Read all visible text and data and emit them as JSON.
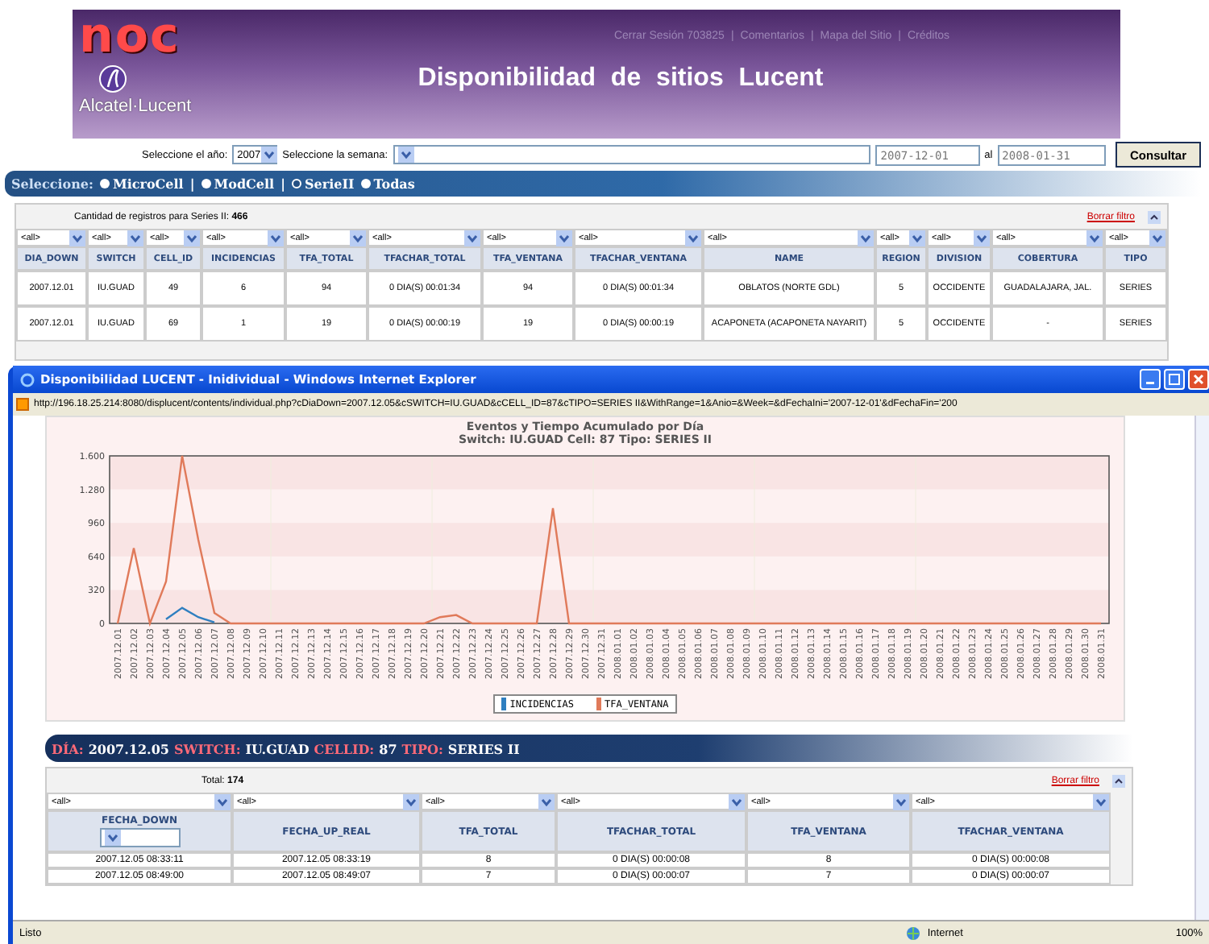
{
  "header": {
    "logo_text": "noc",
    "brand": "Alcatel·Lucent",
    "links": [
      "Cerrar Sesión 703825",
      "Comentarios",
      "Mapa del Sitio",
      "Créditos"
    ],
    "link_separator": "|",
    "title": "Disponibilidad de sitios Lucent"
  },
  "query": {
    "year_label": "Seleccione el año:",
    "year": "2007",
    "week_label": "Seleccione la semana:",
    "date_from": "2007-12-01",
    "range_sep": "al",
    "date_to": "2008-01-31",
    "submit": "Consultar"
  },
  "selector": {
    "label": "Seleccione:",
    "separator": "|",
    "options": [
      {
        "label": "MicroCell",
        "selected": false
      },
      {
        "label": "ModCell",
        "selected": false
      },
      {
        "label": "SerieII",
        "selected": true
      },
      {
        "label": "Todas",
        "selected": false
      }
    ]
  },
  "main_table": {
    "summary": "Cantidad de registros para Series II: **466**",
    "clear_filter": "Borrar filtro",
    "columns": [
      {
        "name": "DIA_DOWN",
        "filter": "<all>"
      },
      {
        "name": "SWITCH",
        "filter": "<all>"
      },
      {
        "name": "CELL_ID",
        "filter": "<all>"
      },
      {
        "name": "INCIDENCIAS",
        "filter": "<all>"
      },
      {
        "name": "TFA_TOTAL",
        "filter": "<all>"
      },
      {
        "name": "TFACHAR_TOTAL",
        "filter": "<all>"
      },
      {
        "name": "TFA_VENTANA",
        "filter": "<all>"
      },
      {
        "name": "TFACHAR_VENTANA",
        "filter": "<all>"
      },
      {
        "name": "NAME",
        "filter": "<all>"
      },
      {
        "name": "REGION",
        "filter": "<all>"
      },
      {
        "name": "DIVISION",
        "filter": "<all>"
      },
      {
        "name": "COBERTURA",
        "filter": "<all>"
      },
      {
        "name": "TIPO",
        "filter": "<all>"
      }
    ],
    "rows": [
      [
        "2007.12.01",
        "IU.GUAD",
        "49",
        "6",
        "94",
        "0 DIA(S) 00:01:34",
        "94",
        "0 DIA(S) 00:01:34",
        "OBLATOS (NORTE GDL)",
        "5",
        "OCCIDENTE",
        "GUADALAJARA, JAL.",
        "SERIES"
      ],
      [
        "2007.12.01",
        "IU.GUAD",
        "69",
        "1",
        "19",
        "0 DIA(S) 00:00:19",
        "19",
        "0 DIA(S) 00:00:19",
        "ACAPONETA (ACAPONETA NAYARIT)",
        "5",
        "OCCIDENTE",
        "-",
        "SERIES"
      ]
    ]
  },
  "popup": {
    "title": "Disponibilidad LUCENT - Inidividual - Windows Internet Explorer",
    "url": "http://196.18.25.214:8080/displucent/contents/individual.php?cDiaDown=2007.12.05&cSWITCH=IU.GUAD&cCELL_ID=87&cTIPO=SERIES II&WithRange=1&Anio=&Week=&dFechaIni='2007-12-01'&dFechaFin='200",
    "chart": {
      "subtitle": "Switch: IU.GUAD Cell: 87 Tipo: SERIES II",
      "chart_data": {
        "type": "line",
        "title": "Eventos y Tiempo Acumulado por Día",
        "categories": [
          "2007.12.01",
          "2007.12.02",
          "2007.12.03",
          "2007.12.04",
          "2007.12.05",
          "2007.12.06",
          "2007.12.07",
          "2007.12.08",
          "2007.12.09",
          "2007.12.10",
          "2007.12.11",
          "2007.12.12",
          "2007.12.13",
          "2007.12.14",
          "2007.12.15",
          "2007.12.16",
          "2007.12.17",
          "2007.12.18",
          "2007.12.19",
          "2007.12.20",
          "2007.12.21",
          "2007.12.22",
          "2007.12.23",
          "2007.12.24",
          "2007.12.25",
          "2007.12.26",
          "2007.12.27",
          "2007.12.28",
          "2007.12.29",
          "2007.12.30",
          "2007.12.31",
          "2008.01.01",
          "2008.01.02",
          "2008.01.03",
          "2008.01.04",
          "2008.01.05",
          "2008.01.06",
          "2008.01.07",
          "2008.01.08",
          "2008.01.09",
          "2008.01.10",
          "2008.01.11",
          "2008.01.12",
          "2008.01.13",
          "2008.01.14",
          "2008.01.15",
          "2008.01.16",
          "2008.01.17",
          "2008.01.18",
          "2008.01.19",
          "2008.01.20",
          "2008.01.21",
          "2008.01.22",
          "2008.01.23",
          "2008.01.24",
          "2008.01.25",
          "2008.01.26",
          "2008.01.27",
          "2008.01.28",
          "2008.01.29",
          "2008.01.30",
          "2008.01.31"
        ],
        "series": [
          {
            "name": "INCIDENCIAS",
            "color": "#2f7fc0",
            "values": [
              null,
              null,
              null,
              40,
              150,
              60,
              10,
              null,
              null,
              null,
              null,
              null,
              null,
              null,
              null,
              null,
              null,
              null,
              null,
              null,
              null,
              null,
              null,
              null,
              null,
              null,
              null,
              null,
              null,
              null,
              null,
              null,
              null,
              null,
              null,
              null,
              null,
              null,
              null,
              null,
              null,
              null,
              null,
              null,
              null,
              null,
              null,
              null,
              null,
              null,
              null,
              null,
              null,
              null,
              null,
              null,
              null,
              null,
              null,
              null,
              null,
              null
            ]
          },
          {
            "name": "TFA_VENTANA",
            "color": "#e07a5a",
            "values": [
              0,
              720,
              0,
              400,
              1600,
              800,
              100,
              0,
              0,
              0,
              0,
              0,
              0,
              0,
              0,
              0,
              0,
              0,
              0,
              0,
              60,
              80,
              0,
              0,
              0,
              0,
              0,
              1100,
              0,
              0,
              0,
              0,
              0,
              0,
              0,
              0,
              0,
              0,
              0,
              0,
              0,
              0,
              0,
              0,
              0,
              0,
              0,
              0,
              0,
              0,
              0,
              0,
              0,
              0,
              0,
              0,
              0,
              0,
              0,
              0,
              0,
              0
            ]
          }
        ],
        "ylim": [
          0,
          1600
        ],
        "yticks": [
          0,
          320,
          640,
          960,
          {
            "value": 1280,
            "label": "1.280"
          },
          {
            "value": 1600,
            "label": "1.600"
          }
        ]
      }
    },
    "detail": {
      "fields": [
        {
          "label": "DÍA:",
          "value": "2007.12.05"
        },
        {
          "label": "SWITCH:",
          "value": "IU.GUAD"
        },
        {
          "label": "CELLID:",
          "value": "87"
        },
        {
          "label": "TIPO:",
          "value": "SERIES II"
        }
      ],
      "total": "Total: **174**",
      "clear_filter": "Borrar filtro",
      "columns": [
        {
          "name": "FECHA_DOWN",
          "filter": "<all>",
          "header_select": true
        },
        {
          "name": "FECHA_UP_REAL",
          "filter": "<all>",
          "header_select": false
        },
        {
          "name": "TFA_TOTAL",
          "filter": "<all>",
          "header_select": false
        },
        {
          "name": "TFACHAR_TOTAL",
          "filter": "<all>",
          "header_select": false
        },
        {
          "name": "TFA_VENTANA",
          "filter": "<all>",
          "header_select": false
        },
        {
          "name": "TFACHAR_VENTANA",
          "filter": "<all>",
          "header_select": false
        }
      ],
      "rows": [
        [
          "2007.12.05 08:33:11",
          "2007.12.05 08:33:19",
          "8",
          "0 DIA(S) 00:00:08",
          "8",
          "0 DIA(S) 00:00:08"
        ],
        [
          "2007.12.05 08:49:00",
          "2007.12.05 08:49:07",
          "7",
          "0 DIA(S) 00:00:07",
          "7",
          "0 DIA(S) 00:00:07"
        ]
      ]
    },
    "status": {
      "text": "Listo",
      "zone": "Internet",
      "zoom": "100%"
    }
  }
}
